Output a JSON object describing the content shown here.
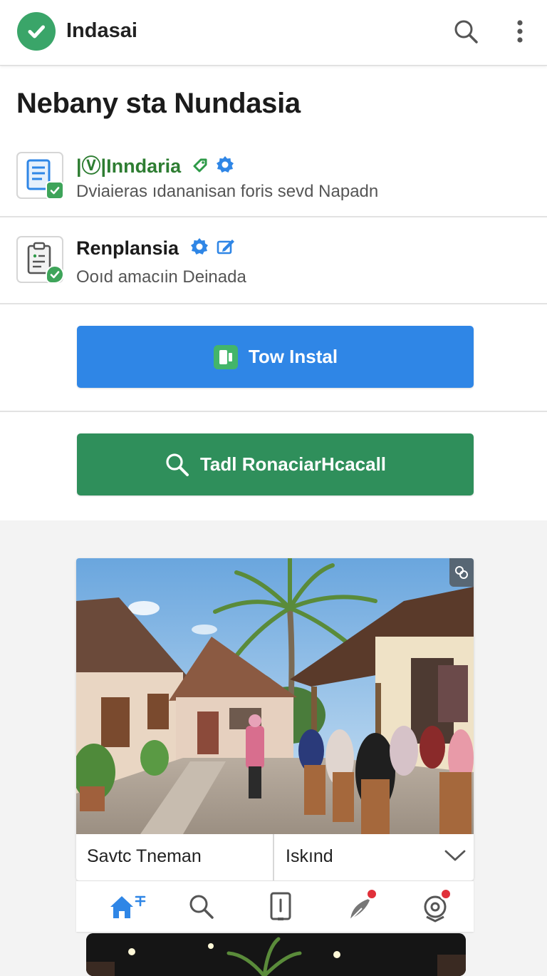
{
  "app": {
    "title": "Indasai"
  },
  "page": {
    "title": "Nebany sta Nundasia"
  },
  "items": [
    {
      "title": "|Ⓥ|Inndaria",
      "subtitle": "Dviaieras ıdananisan foris sevd Napadn",
      "icon": "document-icon",
      "badges": [
        "tag-icon",
        "verified-icon"
      ]
    },
    {
      "title": "Renplansia",
      "subtitle": "Ooıd amacıin Deinada",
      "icon": "clipboard-icon",
      "badges": [
        "verified-icon",
        "edit-icon"
      ]
    }
  ],
  "buttons": {
    "install_label": "Tow Instal",
    "search_label": "Tadl RonaciarHcacall"
  },
  "photo_card": {
    "caption_left": "Savtc Tneman",
    "caption_right": "Iskınd"
  },
  "bottom_nav": [
    "home-icon",
    "search-icon",
    "phone-icon",
    "feather-icon",
    "location-icon"
  ],
  "colors": {
    "brand_green": "#3aa569",
    "install_blue": "#2f86e6",
    "search_green": "#2f8f5b",
    "title_green": "#2e7d32",
    "verified_blue": "#2f86e6",
    "notification_red": "#e0303a",
    "home_blue": "#2f86e6"
  }
}
